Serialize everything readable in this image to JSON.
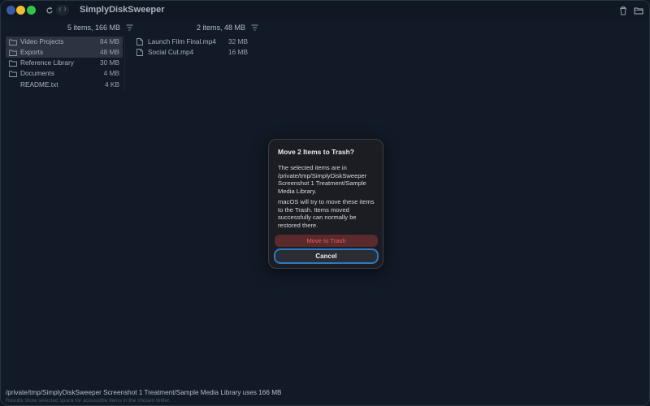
{
  "window": {
    "title": "SimplyDiskSweeper"
  },
  "columns": [
    {
      "header": "5 items, 166 MB",
      "items": [
        {
          "name": "Video Projects",
          "size": "84 MB",
          "kind": "folder",
          "selected": true
        },
        {
          "name": "Exports",
          "size": "48 MB",
          "kind": "folder",
          "selected": true
        },
        {
          "name": "Reference Library",
          "size": "30 MB",
          "kind": "folder",
          "selected": false
        },
        {
          "name": "Documents",
          "size": "4 MB",
          "kind": "folder",
          "selected": false
        },
        {
          "name": "README.txt",
          "size": "4 KB",
          "kind": "file",
          "selected": false
        }
      ]
    },
    {
      "header": "2 items, 48 MB",
      "items": [
        {
          "name": "Launch Film Final.mp4",
          "size": "32 MB",
          "kind": "file"
        },
        {
          "name": "Social Cut.mp4",
          "size": "16 MB",
          "kind": "file"
        }
      ]
    }
  ],
  "footer": {
    "path_summary": "/private/tmp/SimplyDiskSweeper Screenshot 1 Treatment/Sample Media Library uses 166 MB",
    "hint": "Results show selected space for accessible items in the chosen folder."
  },
  "dialog": {
    "title": "Move 2 Items to Trash?",
    "message": "The selected items are in /private/tmp/SimplyDiskSweeper Screenshot 1 Treatment/Sample Media Library.",
    "message2": "macOS will try to move these items to the Trash. Items moved successfully can normally be restored there.",
    "confirm_label": "Move to Trash",
    "cancel_label": "Cancel"
  },
  "colors": {
    "background": "#111a26",
    "destructive_text": "#f05a5f",
    "focus_ring": "#2a7bc4"
  },
  "icons": {
    "refresh": "refresh-icon",
    "trash": "trash-icon",
    "folder": "folder-icon",
    "file": "file-icon",
    "filter": "filter-icon"
  }
}
